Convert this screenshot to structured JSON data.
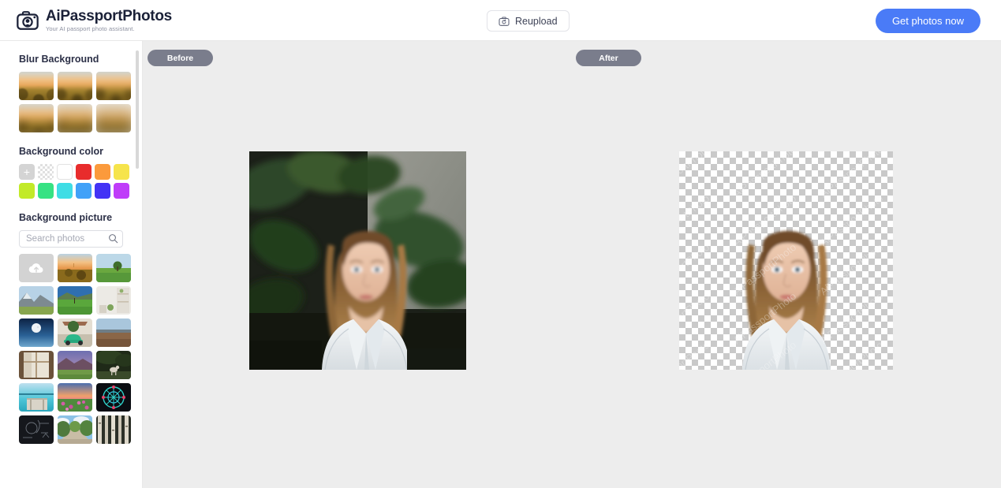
{
  "header": {
    "logo_icon": "camera-icon",
    "brand_title": "AiPassportPhotos",
    "brand_tagline": "Your AI passport photo assistant.",
    "reupload_label": "Reupload",
    "reupload_icon": "camera-refresh-icon",
    "cta_label": "Get photos now",
    "cta_color": "#4a7bf7"
  },
  "sidebar": {
    "blur_background": {
      "title": "Blur Background",
      "items": [
        {
          "name": "blur-level-1",
          "blur": 0.6
        },
        {
          "name": "blur-level-2",
          "blur": 1.6
        },
        {
          "name": "blur-level-3",
          "blur": 2.6
        },
        {
          "name": "blur-level-4",
          "blur": 4.0
        },
        {
          "name": "blur-level-5",
          "blur": 5.5
        },
        {
          "name": "blur-level-6",
          "blur": 7.0
        }
      ]
    },
    "background_color": {
      "title": "Background color",
      "add_label": "+",
      "swatches": [
        {
          "name": "add-color",
          "color": "#d4d4d4",
          "type": "add"
        },
        {
          "name": "transparent",
          "color": "transparent",
          "type": "checker"
        },
        {
          "name": "white",
          "color": "#ffffff",
          "type": "solid"
        },
        {
          "name": "red",
          "color": "#e82c2c",
          "type": "solid"
        },
        {
          "name": "orange",
          "color": "#fb9a3c",
          "type": "solid"
        },
        {
          "name": "yellow",
          "color": "#f6e44b",
          "type": "solid"
        },
        {
          "name": "lime",
          "color": "#c2ea28",
          "type": "solid"
        },
        {
          "name": "green",
          "color": "#36e283",
          "type": "solid"
        },
        {
          "name": "cyan",
          "color": "#3fdde5",
          "type": "solid"
        },
        {
          "name": "blue",
          "color": "#41a1f8",
          "type": "solid"
        },
        {
          "name": "indigo",
          "color": "#4333f5",
          "type": "solid"
        },
        {
          "name": "magenta",
          "color": "#bf3cf9",
          "type": "solid"
        }
      ]
    },
    "background_picture": {
      "title": "Background picture",
      "search_placeholder": "Search photos",
      "search_value": "",
      "search_icon": "search-icon",
      "upload_icon": "cloud-upload-icon",
      "photos": [
        {
          "name": "upload-tile",
          "kind": "upload"
        },
        {
          "name": "sunset-field",
          "kind": "sunset-field"
        },
        {
          "name": "lone-tree-green-field",
          "kind": "lone-tree"
        },
        {
          "name": "rocky-mountain",
          "kind": "rocky-mountain"
        },
        {
          "name": "green-hills",
          "kind": "green-hills"
        },
        {
          "name": "white-interior-shelf",
          "kind": "interior"
        },
        {
          "name": "full-moon-night",
          "kind": "moon-night"
        },
        {
          "name": "green-car-under-tree",
          "kind": "green-car"
        },
        {
          "name": "desert-plain",
          "kind": "desert"
        },
        {
          "name": "window-curtain",
          "kind": "curtain"
        },
        {
          "name": "purple-mountain-valley",
          "kind": "purple-mountain"
        },
        {
          "name": "deer-under-tree",
          "kind": "deer"
        },
        {
          "name": "beach-pier",
          "kind": "beach-pier"
        },
        {
          "name": "flower-field-sunset",
          "kind": "flower-field"
        },
        {
          "name": "ferris-wheel-night",
          "kind": "ferris-wheel"
        },
        {
          "name": "chalkboard-formulas",
          "kind": "chalkboard"
        },
        {
          "name": "tree-lined-path",
          "kind": "tree-path"
        },
        {
          "name": "birch-forest",
          "kind": "birch"
        }
      ]
    }
  },
  "canvas": {
    "before_label": "Before",
    "after_label": "After",
    "background": "#ededed",
    "before_image": {
      "name": "before-portrait",
      "description": "Woman in white shirt in front of monstera plant"
    },
    "after_image": {
      "name": "after-portrait-transparent",
      "description": "Same portrait with background removed on transparency checkerboard",
      "watermark": "AiPassportPhoto"
    }
  }
}
